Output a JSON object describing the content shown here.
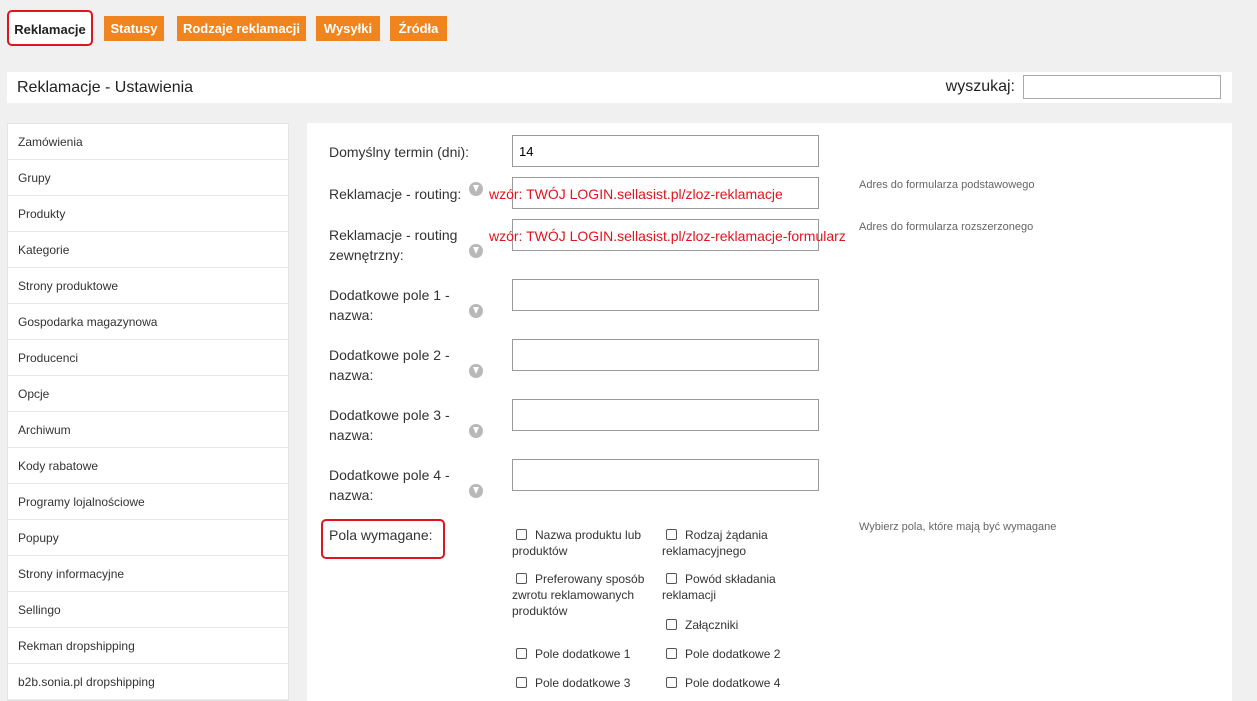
{
  "tabs": [
    {
      "label": "Reklamacje",
      "active": true
    },
    {
      "label": "Statusy"
    },
    {
      "label": "Rodzaje reklamacji"
    },
    {
      "label": "Wysyłki"
    },
    {
      "label": "Źródła"
    }
  ],
  "header": {
    "title": "Reklamacje - Ustawienia",
    "search_label": "wyszukaj:",
    "search_value": ""
  },
  "sidebar": {
    "items": [
      "Zamówienia",
      "Grupy",
      "Produkty",
      "Kategorie",
      "Strony produktowe",
      "Gospodarka magazynowa",
      "Producenci",
      "Opcje",
      "Archiwum",
      "Kody rabatowe",
      "Programy lojalnościowe",
      "Popupy",
      "Strony informacyjne",
      "Sellingo",
      "Rekman dropshipping",
      "b2b.sonia.pl dropshipping"
    ]
  },
  "form": {
    "default_term": {
      "label": "Domyślny termin (dni):",
      "value": "14"
    },
    "routing": {
      "label": "Reklamacje - routing:",
      "overlay": "wzór: TWÓJ LOGIN.sellasist.pl/zloz-reklamacje",
      "hint": "Adres do formularza podstawowego"
    },
    "routing_ext": {
      "label_line1": "Reklamacje - routing",
      "label_line2": "zewnętrzny:",
      "overlay": "wzór: TWÓJ LOGIN.sellasist.pl/zloz-reklamacje-formularz",
      "hint": "Adres do formularza rozszerzonego"
    },
    "extra_fields": [
      {
        "line1": "Dodatkowe pole 1 -",
        "line2": "nazwa:",
        "value": ""
      },
      {
        "line1": "Dodatkowe pole 2 -",
        "line2": "nazwa:",
        "value": ""
      },
      {
        "line1": "Dodatkowe pole 3 -",
        "line2": "nazwa:",
        "value": ""
      },
      {
        "line1": "Dodatkowe pole 4 -",
        "line2": "nazwa:",
        "value": ""
      }
    ],
    "required": {
      "label": "Pola wymagane:",
      "hint": "Wybierz pola, które mają być wymagane",
      "options": {
        "product_name": {
          "line1": "Nazwa produktu lub",
          "line2": "produktów"
        },
        "request_type": {
          "line1": "Rodzaj żądania",
          "line2": "reklamacyjnego"
        },
        "return_method": {
          "line1": "Preferowany sposób",
          "line2": "zwrotu reklamowanych",
          "line3": "produktów"
        },
        "reason": {
          "line1": "Powód składania",
          "line2": "reklamacji"
        },
        "attachments": "Załączniki",
        "extra1": "Pole dodatkowe 1",
        "extra2": "Pole dodatkowe 2",
        "extra3": "Pole dodatkowe 3",
        "extra4": "Pole dodatkowe 4"
      }
    }
  },
  "colors": {
    "accent": "#f0851f",
    "highlight": "#e0141e"
  }
}
